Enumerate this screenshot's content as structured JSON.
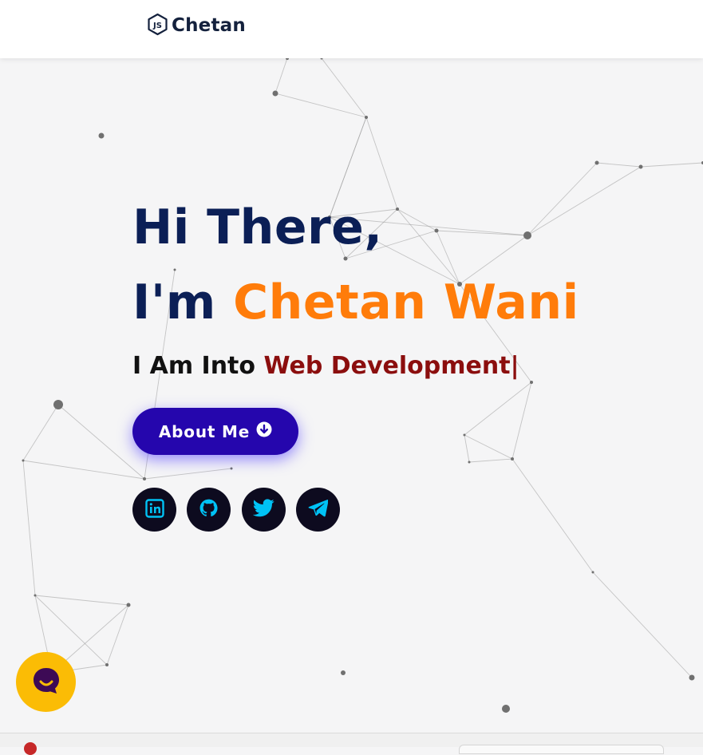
{
  "nav": {
    "brand": "Chetan",
    "logo_icon": "nodejs-logo-icon"
  },
  "hero": {
    "greeting": "Hi There,",
    "intro_prefix": "I'm ",
    "name": "Chetan Wani",
    "subtitle_prefix": "I Am Into ",
    "typed_text": "Web Development",
    "cursor": "|",
    "about_button": "About Me",
    "about_icon": "arrow-down-circle-icon",
    "socials": [
      {
        "name": "linkedin",
        "icon": "linkedin-icon"
      },
      {
        "name": "github",
        "icon": "github-icon"
      },
      {
        "name": "twitter",
        "icon": "twitter-icon"
      },
      {
        "name": "telegram",
        "icon": "telegram-icon"
      }
    ]
  },
  "chat_widget": {
    "icon": "chat-bubble-icon"
  },
  "colors": {
    "heading": "#0b1f56",
    "accent": "#ff7c0a",
    "typed": "#8b0e0e",
    "button": "#2506ad",
    "social_bg": "#0d0b1f",
    "social_icon": "#00c2f5",
    "chat_bg": "#fbbc05",
    "background": "#f5f5f6"
  }
}
